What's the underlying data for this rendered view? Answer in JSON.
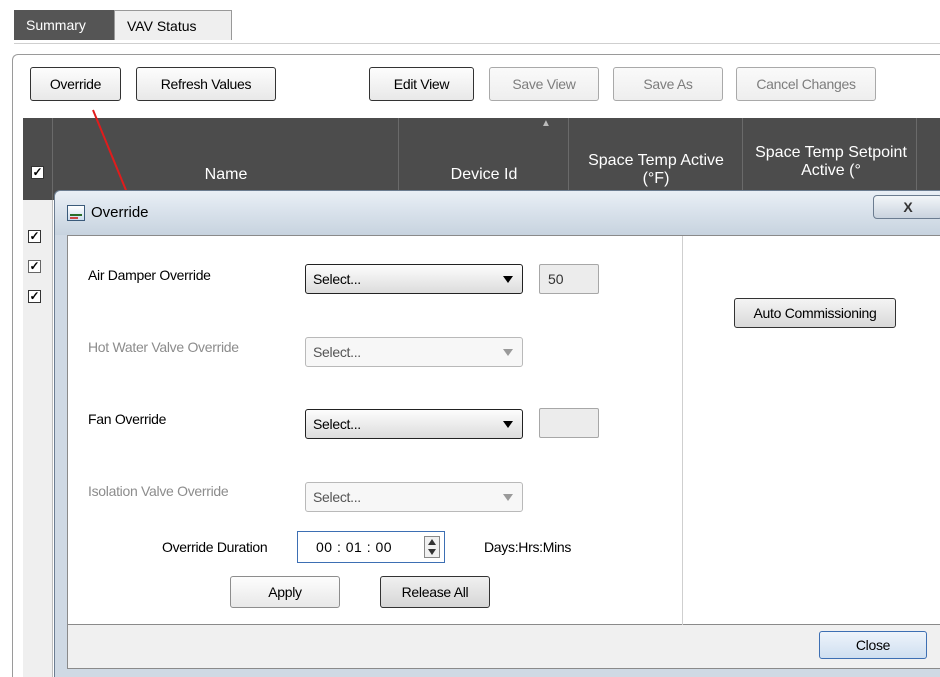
{
  "tabs": [
    {
      "label": "Summary"
    },
    {
      "label": "VAV Status"
    }
  ],
  "toolbar": {
    "override": "Override",
    "refresh": "Refresh Values",
    "edit_view": "Edit View",
    "save_view": "Save View",
    "save_as": "Save As",
    "cancel_changes": "Cancel Changes"
  },
  "grid": {
    "columns": [
      "Name",
      "Device Id",
      "Space Temp Active (°F)",
      "Space Temp Setpoint Active (°"
    ],
    "rows_checked": [
      true,
      true,
      true
    ]
  },
  "dialog": {
    "title": "Override",
    "close_glyph": "X",
    "air_damper": {
      "label": "Air Damper Override",
      "select": "Select...",
      "value": "50"
    },
    "hot_water": {
      "label": "Hot Water Valve Override",
      "select": "Select..."
    },
    "fan": {
      "label": "Fan Override",
      "select": "Select...",
      "value": ""
    },
    "isolation": {
      "label": "Isolation Valve Override",
      "select": "Select..."
    },
    "duration": {
      "label": "Override Duration",
      "value": "00 : 01 : 00",
      "units": "Days:Hrs:Mins"
    },
    "apply": "Apply",
    "release_all": "Release All",
    "auto_commissioning": "Auto Commissioning",
    "close": "Close"
  },
  "colors": {
    "header_bg": "#4c4c4c",
    "annotation_line": "#e01c1c",
    "dialog_frame": "#cfd9e4"
  }
}
